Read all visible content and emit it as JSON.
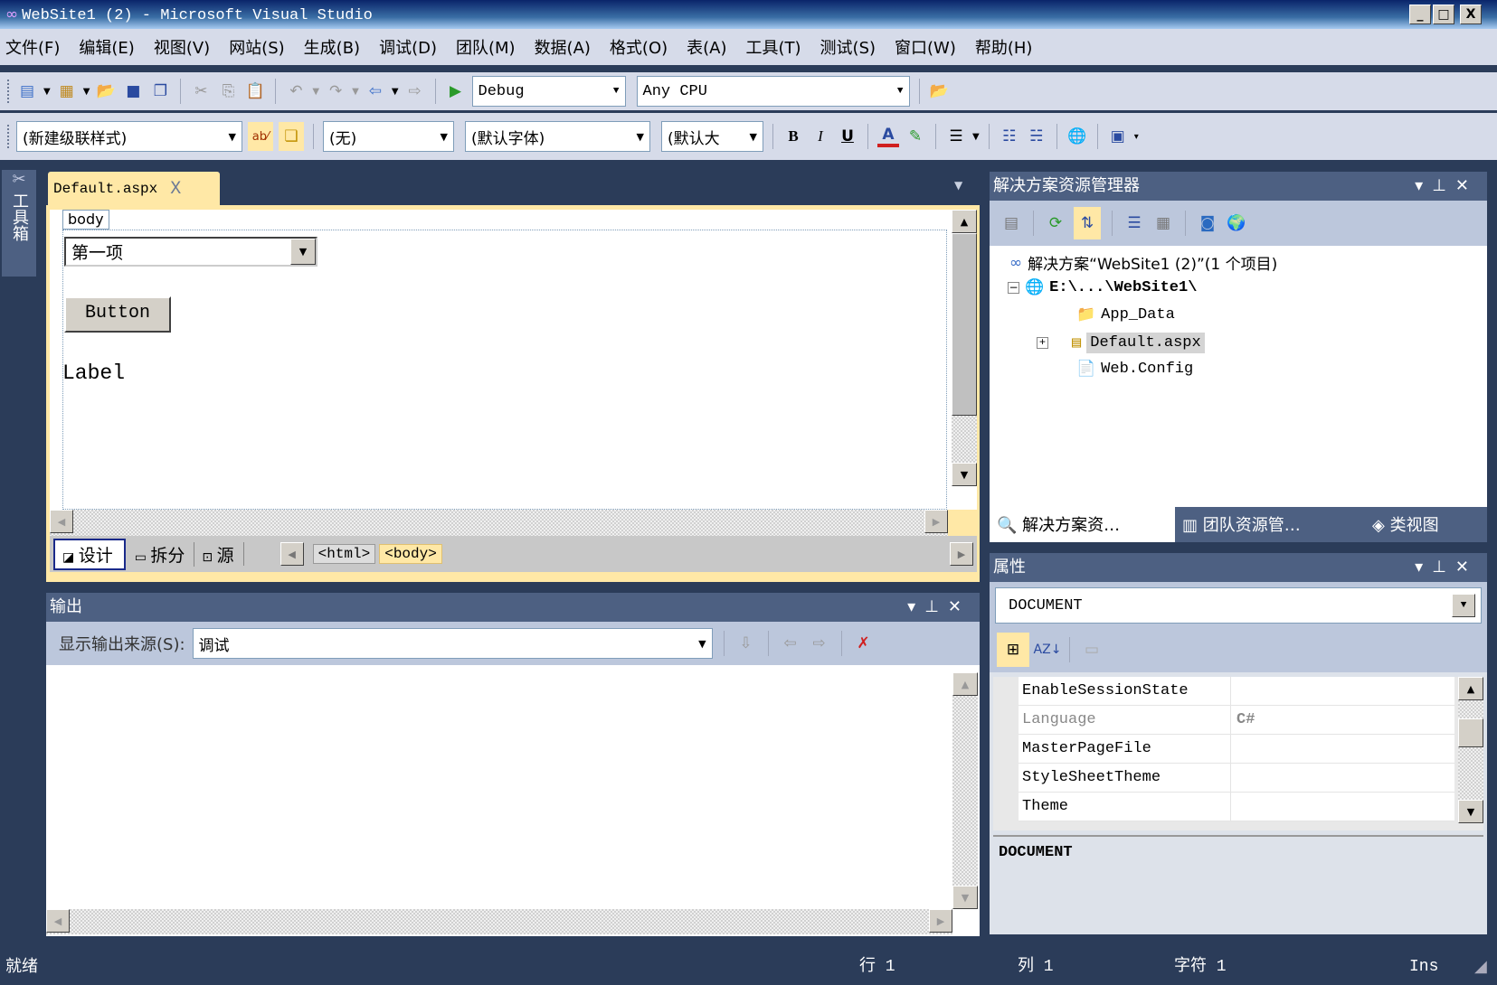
{
  "window": {
    "title": "WebSite1 (2) - Microsoft Visual Studio",
    "minimize": "_",
    "maximize": "□",
    "close": "X"
  },
  "menu": [
    "文件(F)",
    "编辑(E)",
    "视图(V)",
    "网站(S)",
    "生成(B)",
    "调试(D)",
    "团队(M)",
    "数据(A)",
    "格式(O)",
    "表(A)",
    "工具(T)",
    "测试(S)",
    "窗口(W)",
    "帮助(H)"
  ],
  "toolbar1": {
    "config": "Debug",
    "platform": "Any CPU"
  },
  "toolbar2": {
    "style": "(新建级联样式)",
    "block": "(无)",
    "font": "(默认字体)",
    "size": "(默认大",
    "bold": "B",
    "italic": "I",
    "underline": "U",
    "font_color": "A"
  },
  "toolbox": {
    "label": "工具箱"
  },
  "document": {
    "tab": "Default.aspx",
    "close": "X",
    "tag_label": "body",
    "dropdown_value": "第一项",
    "button_label": "Button",
    "label_text": "Label",
    "views": [
      "设计",
      "拆分",
      "源"
    ],
    "breadcrumb": [
      "<html>",
      "<body>"
    ]
  },
  "output": {
    "title": "输出",
    "source_label": "显示输出来源(S):",
    "source_value": "调试"
  },
  "solution_explorer": {
    "title": "解决方案资源管理器",
    "solution": "解决方案“WebSite1 (2)”(1 个项目)",
    "project": "E:\\...\\WebSite1\\",
    "items": [
      "App_Data",
      "Default.aspx",
      "Web.Config"
    ],
    "tabs": [
      "解决方案资…",
      "团队资源管…",
      "类视图"
    ]
  },
  "properties": {
    "title": "属性",
    "object": "DOCUMENT",
    "rows": [
      {
        "name": "EnableSessionState",
        "value": ""
      },
      {
        "name": "Language",
        "value": "C#"
      },
      {
        "name": "MasterPageFile",
        "value": ""
      },
      {
        "name": "StyleSheetTheme",
        "value": ""
      },
      {
        "name": "Theme",
        "value": ""
      }
    ],
    "description": "DOCUMENT"
  },
  "status": {
    "ready": "就绪",
    "line": "行 1",
    "col": "列 1",
    "char": "字符 1",
    "mode": "Ins"
  },
  "colors": {
    "frame": "#2b3c59",
    "panel_title": "#4d6082",
    "toolbar": "#d6dbe9",
    "active_tab": "#ffe8a6"
  }
}
